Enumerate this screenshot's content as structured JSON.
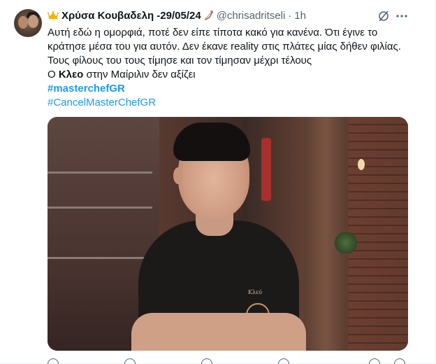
{
  "author": {
    "display_name": "Χρύσα Κουβαδελη -29/05/24",
    "handle": "@chrisadritseli",
    "separator": "·",
    "timestamp": "1h"
  },
  "tweet": {
    "line1": "Αυτή εδώ η ομορφιά, ποτέ δεν είπε τίποτα κακό για κανένα. Ότι έγινε το",
    "line2": "κράτησε μέσα του για αυτόν. Δεν έκανε reality στις πλάτες μίας δήθεν φιλίας.",
    "line3": "Τους φίλους του τους τίμησε και τον τίμησαν μέχρι τέλους",
    "line4_prefix": "Ο ",
    "line4_bold": "Κλεο",
    "line4_suffix": " στην Μαίριλιν δεν αξίζει",
    "hashtag1": "#masterchefGR",
    "hashtag2": "#CancelMasterChefGR"
  },
  "media": {
    "name_tag": "Κλεό"
  },
  "icons": {
    "crown": "crown-icon",
    "bow": "bow-and-arrow-icon",
    "grok": "grok-icon",
    "more": "more-icon"
  },
  "colors": {
    "link": "#1d9bf0",
    "secondary_text": "#536471",
    "crown": "#f4b400"
  }
}
